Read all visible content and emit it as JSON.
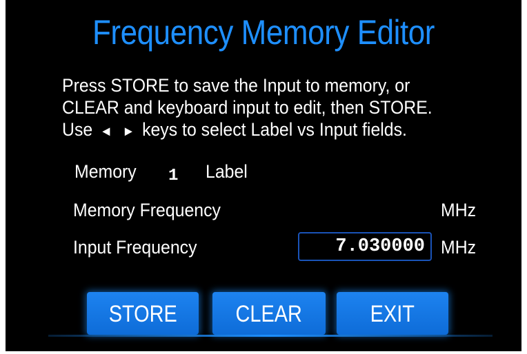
{
  "title": "Frequency Memory Editor",
  "instructions": {
    "line1": "Press STORE to save the Input to memory, or",
    "line2": "CLEAR and keyboard input to edit, then STORE.",
    "line3_prefix": "Use",
    "line3_left_arrow": "◄",
    "line3_right_arrow": "►",
    "line3_suffix": "keys to select Label vs Input fields."
  },
  "memory": {
    "label_prefix": "Memory",
    "number": "1",
    "label_text": "Label"
  },
  "memory_frequency": {
    "label": "Memory Frequency",
    "unit": "MHz"
  },
  "input_frequency": {
    "label": "Input Frequency",
    "value": "7.030000",
    "unit": "MHz"
  },
  "buttons": {
    "store": "STORE",
    "clear": "CLEAR",
    "exit": "EXIT"
  },
  "colors": {
    "accent": "#1e8fff",
    "button": "#1a7fe8",
    "input_border": "#1a53b8",
    "background": "#000000"
  }
}
